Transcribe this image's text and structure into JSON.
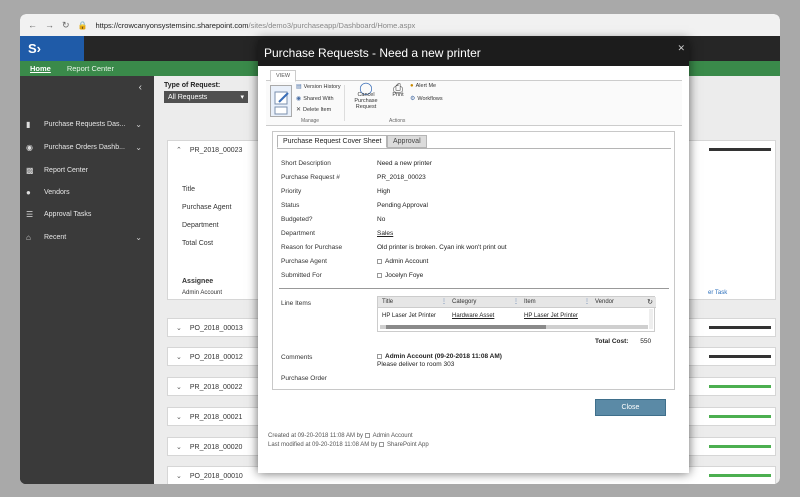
{
  "browser": {
    "url_host": "https://crowcanyonsystemsinc.sharepoint.com",
    "url_path": "/sites/demo3/purchaseapp/Dashboard/Home.aspx"
  },
  "suitebar": {
    "home": "Home",
    "report_center": "Report Center"
  },
  "sidebar": {
    "items": [
      {
        "label": "Purchase Requests Das...",
        "icon": "clipboard-icon"
      },
      {
        "label": "Purchase Orders Dashb...",
        "icon": "dashboard-icon"
      },
      {
        "label": "Report Center",
        "icon": "chart-icon"
      },
      {
        "label": "Vendors",
        "icon": "people-icon"
      },
      {
        "label": "Approval Tasks",
        "icon": "tasks-icon"
      },
      {
        "label": "Recent",
        "icon": "home-icon"
      }
    ]
  },
  "filter": {
    "label": "Type of Request:",
    "value": "All Requests"
  },
  "background_list": {
    "expanded_id": "PR_2018_00023",
    "fields": [
      "Title",
      "Purchase Agent",
      "Department",
      "Total Cost"
    ],
    "assignee_label": "Assignee",
    "assignee_value": "Admin Account",
    "task_link": "er Task",
    "rows": [
      "PO_2018_00013",
      "PO_2018_00012",
      "PR_2018_00022",
      "PR_2018_00021",
      "PR_2018_00020",
      "PO_2018_00010"
    ]
  },
  "modal": {
    "title": "Purchase Requests - Need a new printer",
    "ribbon_tab": "VIEW",
    "ribbon": {
      "version_history": "Version History",
      "shared_with": "Shared With",
      "delete_item": "Delete Item",
      "manage": "Manage",
      "cancel_request": "Cancel Purchase Request",
      "print": "Print",
      "alert_me": "Alert Me",
      "workflows": "Workflows",
      "actions": "Actions"
    },
    "tabs": [
      "Purchase Request Cover Sheet",
      "Approval"
    ],
    "fields": [
      {
        "label": "Short Description",
        "value": "Need a new printer"
      },
      {
        "label": "Purchase Request #",
        "value": "PR_2018_00023"
      },
      {
        "label": "Priority",
        "value": "High"
      },
      {
        "label": "Status",
        "value": "Pending Approval"
      },
      {
        "label": "Budgeted?",
        "value": "No"
      },
      {
        "label": "Department",
        "value": "Sales"
      },
      {
        "label": "Reason for Purchase",
        "value": "Old printer is broken. Cyan ink won't print out"
      },
      {
        "label": "Purchase Agent",
        "value": "Admin Account"
      },
      {
        "label": "Submitted For",
        "value": "Jocelyn Foye"
      }
    ],
    "line_items_label": "Line Items",
    "grid": {
      "columns": [
        "Title",
        "Category",
        "Item",
        "Vendor"
      ],
      "row": [
        "HP Laser Jet Printer",
        "Hardware Asset",
        "HP Laser Jet Printer",
        ""
      ]
    },
    "total_cost_label": "Total Cost:",
    "total_cost_value": "550",
    "comments_label": "Comments",
    "comment_author": "Admin Account (09-20-2018 11:08 AM)",
    "comment_text": "Please deliver to room 303",
    "purchase_order_label": "Purchase Order",
    "close_label": "Close",
    "created": "Created at 09-20-2018 11:08 AM by",
    "created_by": "Admin Account",
    "modified": "Last modified at 09-20-2018 11:08 AM by",
    "modified_by": "SharePoint App"
  }
}
